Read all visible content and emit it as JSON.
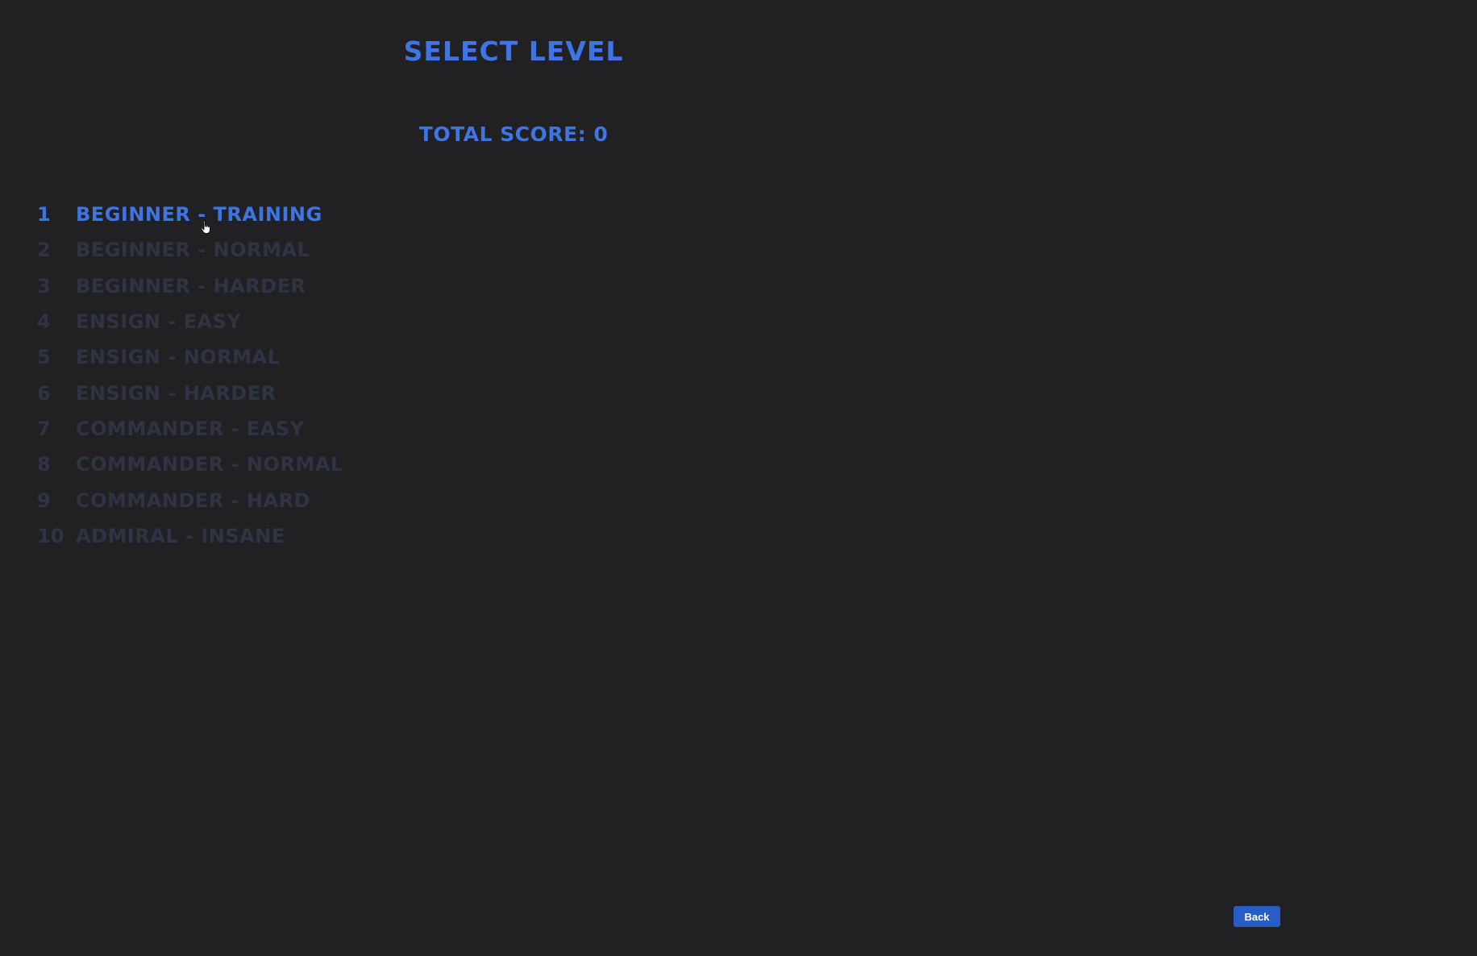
{
  "screen": {
    "title": "SELECT LEVEL",
    "total_score_label": "TOTAL SCORE:",
    "total_score_value": "0"
  },
  "levels": [
    {
      "number": "1",
      "name": "BEGINNER - TRAINING",
      "selected": true
    },
    {
      "number": "2",
      "name": "BEGINNER - NORMAL",
      "selected": false
    },
    {
      "number": "3",
      "name": "BEGINNER - HARDER",
      "selected": false
    },
    {
      "number": "4",
      "name": "ENSIGN - EASY",
      "selected": false
    },
    {
      "number": "5",
      "name": "ENSIGN - NORMAL",
      "selected": false
    },
    {
      "number": "6",
      "name": "ENSIGN - HARDER",
      "selected": false
    },
    {
      "number": "7",
      "name": "COMMANDER - EASY",
      "selected": false
    },
    {
      "number": "8",
      "name": "COMMANDER - NORMAL",
      "selected": false
    },
    {
      "number": "9",
      "name": "COMMANDER - HARD",
      "selected": false
    },
    {
      "number": "10",
      "name": "ADMIRAL - INSANE",
      "selected": false
    }
  ],
  "footer": {
    "back_label": "Back"
  },
  "colors": {
    "background": "#212123",
    "accent": "#3d75e4",
    "dimmed": "#2f3445",
    "button": "#2a5cc5"
  },
  "icons": {
    "cursor": "hand-pointer-icon"
  }
}
